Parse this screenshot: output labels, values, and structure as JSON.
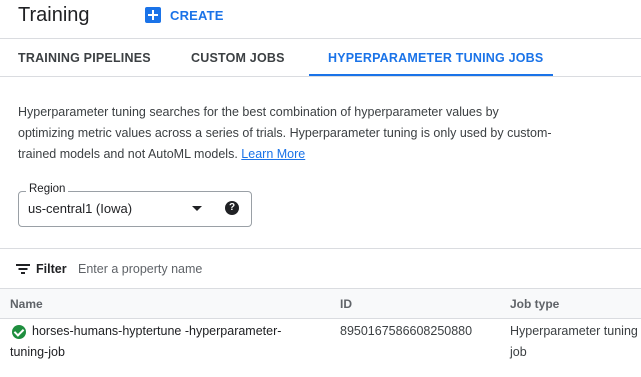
{
  "header": {
    "title": "Training",
    "create_label": "CREATE"
  },
  "tabs": [
    {
      "label": "TRAINING PIPELINES",
      "active": false
    },
    {
      "label": "CUSTOM JOBS",
      "active": false
    },
    {
      "label": "HYPERPARAMETER TUNING JOBS",
      "active": true
    }
  ],
  "description": {
    "text": "Hyperparameter tuning searches for the best combination of hyperparameter values by optimizing metric values across a series of trials. Hyperparameter tuning is only used by custom-trained models and not AutoML models.",
    "link_label": "Learn More"
  },
  "region": {
    "label": "Region",
    "value": "us-central1 (Iowa)",
    "help_glyph": "?"
  },
  "filter": {
    "label": "Filter",
    "placeholder": "Enter a property name"
  },
  "table": {
    "columns": [
      "Name",
      "ID",
      "Job type"
    ],
    "rows": [
      {
        "status": "succeeded",
        "name": "horses-humans-hyptertune -hyperparameter-tuning-job",
        "id": "8950167586608250880",
        "job_type": "Hyperparameter tuning job"
      }
    ]
  },
  "colors": {
    "accent": "#1a73e8",
    "success": "#1e8e3e"
  },
  "icons": [
    "add-icon",
    "dropdown-arrow-icon",
    "help-icon",
    "filter-icon",
    "success-check-icon"
  ]
}
